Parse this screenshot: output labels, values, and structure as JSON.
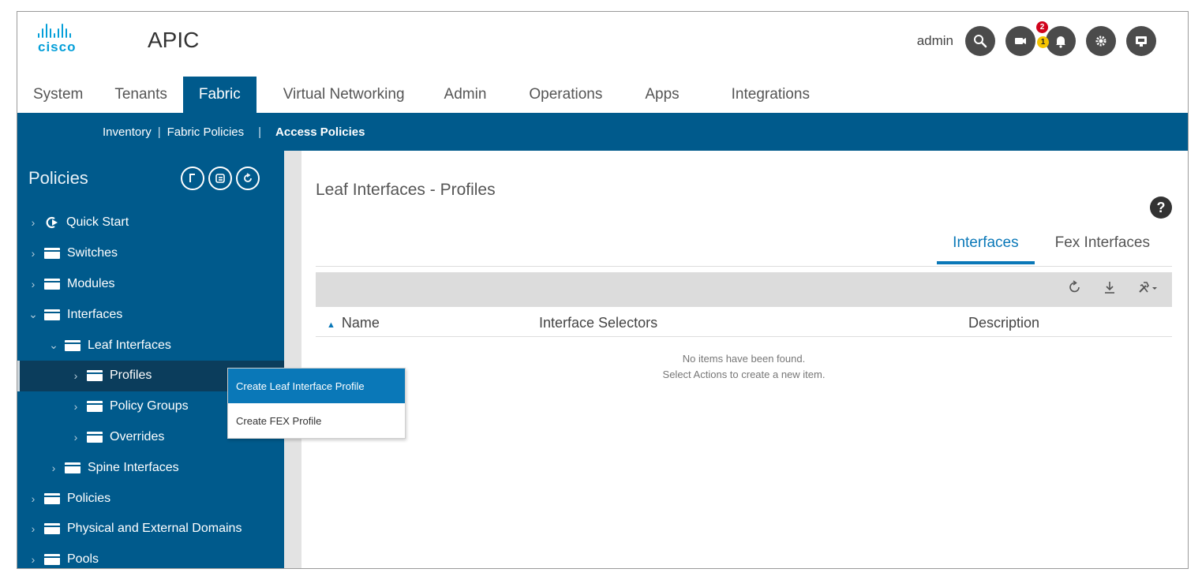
{
  "header": {
    "logo_text": "cisco",
    "app_title": "APIC",
    "username": "admin",
    "alerts": {
      "critical_count": "2",
      "warning_count": "1"
    },
    "icons": [
      "search-icon",
      "feedback-icon",
      "bell-icon",
      "gear-icon",
      "screen-icon"
    ]
  },
  "main_tabs": [
    {
      "label": "System"
    },
    {
      "label": "Tenants"
    },
    {
      "label": "Fabric"
    },
    {
      "label": "Virtual Networking"
    },
    {
      "label": "Admin"
    },
    {
      "label": "Operations"
    },
    {
      "label": "Apps"
    },
    {
      "label": "Integrations"
    }
  ],
  "active_main_tab": "Fabric",
  "subnav": {
    "items": [
      {
        "label": "Inventory"
      },
      {
        "label": "Fabric Policies"
      },
      {
        "label": "Access Policies"
      }
    ],
    "separator": "|",
    "active": "Access Policies"
  },
  "sidebar": {
    "title": "Policies",
    "tree": [
      {
        "label": "Quick Start",
        "depth": 0,
        "expanded": false
      },
      {
        "label": "Switches",
        "depth": 0,
        "expanded": false
      },
      {
        "label": "Modules",
        "depth": 0,
        "expanded": false
      },
      {
        "label": "Interfaces",
        "depth": 0,
        "expanded": true
      },
      {
        "label": "Leaf Interfaces",
        "depth": 1,
        "expanded": true
      },
      {
        "label": "Profiles",
        "depth": 2,
        "expanded": false,
        "selected": true
      },
      {
        "label": "Policy Groups",
        "depth": 2,
        "expanded": false
      },
      {
        "label": "Overrides",
        "depth": 2,
        "expanded": false
      },
      {
        "label": "Spine Interfaces",
        "depth": 1,
        "expanded": false
      },
      {
        "label": "Policies",
        "depth": 0,
        "expanded": false
      },
      {
        "label": "Physical and External Domains",
        "depth": 0,
        "expanded": false
      },
      {
        "label": "Pools",
        "depth": 0,
        "expanded": false
      }
    ]
  },
  "context_menu": {
    "items": [
      {
        "label": "Create Leaf Interface Profile",
        "highlighted": true
      },
      {
        "label": "Create FEX Profile"
      }
    ]
  },
  "content": {
    "title": "Leaf Interfaces - Profiles",
    "help": "?",
    "tabs": [
      {
        "label": "Interfaces"
      },
      {
        "label": "Fex Interfaces"
      }
    ],
    "active_tab": "Interfaces",
    "columns": [
      "Name",
      "Interface Selectors",
      "Description"
    ],
    "sorted_column": "Name",
    "sort_direction": "ascending",
    "empty_line1": "No items have been found.",
    "empty_line2": "Select Actions to create a new item."
  },
  "colors": {
    "nav_blue": "#005a8c",
    "selected_row": "#0b3d5c",
    "accent": "#0a78b8",
    "cisco_blue": "#049fd9",
    "badge_red": "#d0021b",
    "badge_yellow": "#f5c400"
  }
}
